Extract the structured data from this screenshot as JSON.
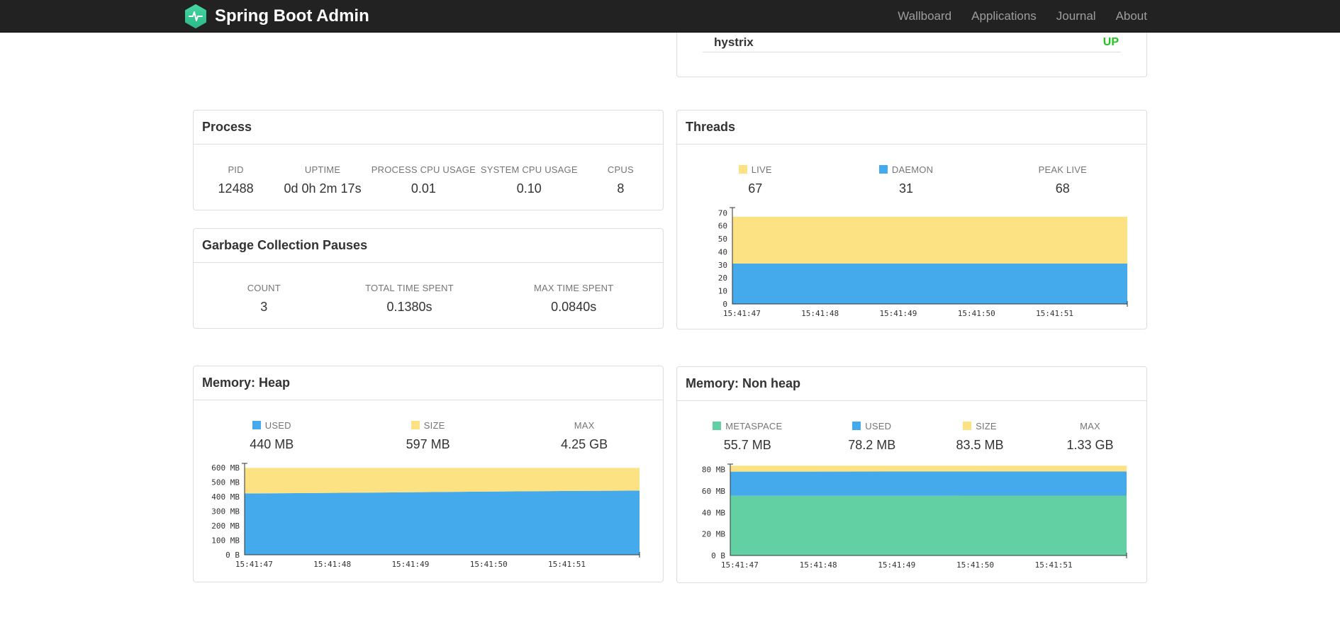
{
  "navbar": {
    "brand": "Spring Boot Admin",
    "items": [
      {
        "label": "Wallboard"
      },
      {
        "label": "Applications"
      },
      {
        "label": "Journal"
      },
      {
        "label": "About"
      }
    ]
  },
  "application_status": {
    "name": "hystrix",
    "status": "UP",
    "status_color": "#21c421"
  },
  "process": {
    "title": "Process",
    "stats": [
      {
        "label": "PID",
        "value": "12488"
      },
      {
        "label": "UPTIME",
        "value": "0d 0h 2m 17s"
      },
      {
        "label": "PROCESS CPU USAGE",
        "value": "0.01"
      },
      {
        "label": "SYSTEM CPU USAGE",
        "value": "0.10"
      },
      {
        "label": "CPUS",
        "value": "8"
      }
    ]
  },
  "gc": {
    "title": "Garbage Collection Pauses",
    "stats": [
      {
        "label": "COUNT",
        "value": "3"
      },
      {
        "label": "TOTAL TIME SPENT",
        "value": "0.1380s"
      },
      {
        "label": "MAX TIME SPENT",
        "value": "0.0840s"
      }
    ]
  },
  "threads": {
    "title": "Threads",
    "stats": [
      {
        "label": "LIVE",
        "value": "67",
        "color": "#fde283"
      },
      {
        "label": "DAEMON",
        "value": "31",
        "color": "#45aaec"
      },
      {
        "label": "PEAK LIVE",
        "value": "68"
      }
    ]
  },
  "heap": {
    "title": "Memory: Heap",
    "stats": [
      {
        "label": "USED",
        "value": "440 MB",
        "color": "#45aaec"
      },
      {
        "label": "SIZE",
        "value": "597 MB",
        "color": "#fde283"
      },
      {
        "label": "MAX",
        "value": "4.25 GB"
      }
    ]
  },
  "nonheap": {
    "title": "Memory: Non heap",
    "stats": [
      {
        "label": "METASPACE",
        "value": "55.7 MB",
        "color": "#63d0a4"
      },
      {
        "label": "USED",
        "value": "78.2 MB",
        "color": "#45aaec"
      },
      {
        "label": "SIZE",
        "value": "83.5 MB",
        "color": "#fde283"
      },
      {
        "label": "MAX",
        "value": "1.33 GB"
      }
    ]
  },
  "chart_data": [
    {
      "id": "threads",
      "type": "area",
      "stacked": "cumulative",
      "ymax": 74,
      "yticks": [
        {
          "v": 0,
          "label": "0"
        },
        {
          "v": 10,
          "label": "10"
        },
        {
          "v": 20,
          "label": "20"
        },
        {
          "v": 30,
          "label": "30"
        },
        {
          "v": 40,
          "label": "40"
        },
        {
          "v": 50,
          "label": "50"
        },
        {
          "v": 60,
          "label": "60"
        },
        {
          "v": 70,
          "label": "70"
        }
      ],
      "xticks": [
        {
          "f": 0.024,
          "label": "15:41:47"
        },
        {
          "f": 0.222,
          "label": "15:41:48"
        },
        {
          "f": 0.42,
          "label": "15:41:49"
        },
        {
          "f": 0.618,
          "label": "15:41:50"
        },
        {
          "f": 0.816,
          "label": "15:41:51"
        }
      ],
      "x_fracs": [
        0,
        0.2,
        0.4,
        0.6,
        0.8,
        1
      ],
      "series": [
        {
          "name": "daemon",
          "color": "#45aaec",
          "values": [
            31,
            31,
            31,
            31,
            31,
            31
          ]
        },
        {
          "name": "live",
          "color": "#fde283",
          "values": [
            67,
            67,
            67,
            67,
            67,
            67
          ]
        }
      ]
    },
    {
      "id": "heap",
      "type": "area",
      "stacked": "cumulative",
      "ymax": 628,
      "yticks": [
        {
          "v": 0,
          "label": "0 B"
        },
        {
          "v": 100,
          "label": "100 MB"
        },
        {
          "v": 200,
          "label": "200 MB"
        },
        {
          "v": 300,
          "label": "300 MB"
        },
        {
          "v": 400,
          "label": "400 MB"
        },
        {
          "v": 500,
          "label": "500 MB"
        },
        {
          "v": 600,
          "label": "600 MB"
        }
      ],
      "xticks": [
        {
          "f": 0.024,
          "label": "15:41:47"
        },
        {
          "f": 0.222,
          "label": "15:41:48"
        },
        {
          "f": 0.42,
          "label": "15:41:49"
        },
        {
          "f": 0.618,
          "label": "15:41:50"
        },
        {
          "f": 0.816,
          "label": "15:41:51"
        }
      ],
      "x_fracs": [
        0,
        0.2,
        0.4,
        0.6,
        0.8,
        1
      ],
      "series": [
        {
          "name": "used",
          "color": "#45aaec",
          "values": [
            421,
            425,
            429,
            434,
            438,
            441
          ]
        },
        {
          "name": "size",
          "color": "#fde283",
          "values": [
            597,
            597,
            597,
            597,
            597,
            597
          ]
        }
      ]
    },
    {
      "id": "nonheap",
      "type": "area",
      "stacked": "cumulative",
      "ymax": 85,
      "yticks": [
        {
          "v": 0,
          "label": "0 B"
        },
        {
          "v": 20,
          "label": "20 MB"
        },
        {
          "v": 40,
          "label": "40 MB"
        },
        {
          "v": 60,
          "label": "60 MB"
        },
        {
          "v": 80,
          "label": "80 MB"
        }
      ],
      "xticks": [
        {
          "f": 0.024,
          "label": "15:41:47"
        },
        {
          "f": 0.222,
          "label": "15:41:48"
        },
        {
          "f": 0.42,
          "label": "15:41:49"
        },
        {
          "f": 0.618,
          "label": "15:41:50"
        },
        {
          "f": 0.816,
          "label": "15:41:51"
        }
      ],
      "x_fracs": [
        0,
        0.2,
        0.4,
        0.6,
        0.8,
        1
      ],
      "series": [
        {
          "name": "metaspace",
          "color": "#63d0a4",
          "values": [
            55.5,
            55.6,
            55.6,
            55.7,
            55.7,
            55.7
          ]
        },
        {
          "name": "used",
          "color": "#45aaec",
          "values": [
            78.0,
            78.0,
            78.1,
            78.1,
            78.2,
            78.2
          ]
        },
        {
          "name": "size",
          "color": "#fde283",
          "values": [
            83.5,
            83.5,
            83.5,
            83.5,
            83.5,
            83.5
          ]
        }
      ]
    }
  ]
}
